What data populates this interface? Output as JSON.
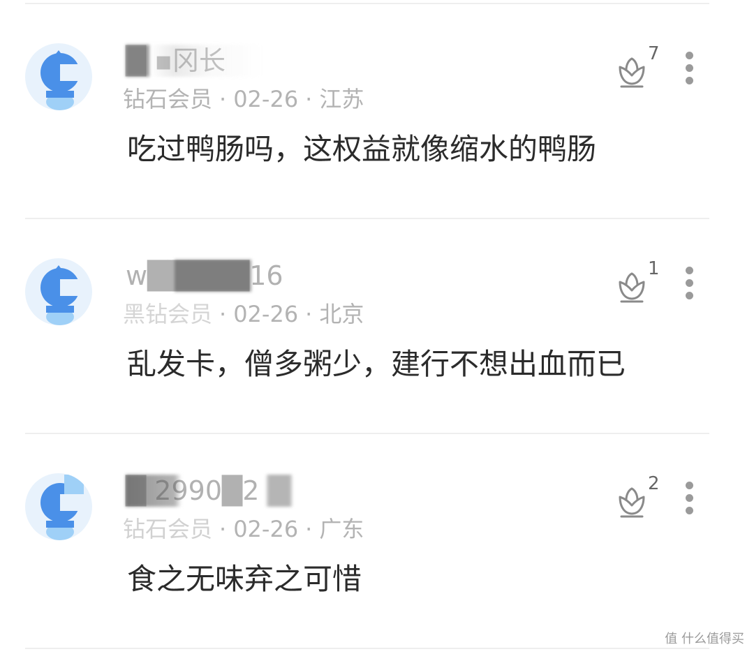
{
  "comments": [
    {
      "username": "█    ▪冈长",
      "member_level": "钻石会员",
      "date": "02-26",
      "location": "江苏",
      "content": "吃过鸭肠吗，这权益就像缩水的鸭肠",
      "like_count": "7"
    },
    {
      "username": "w█████16",
      "member_level": "黑钻会员",
      "date": "02-26",
      "location": "北京",
      "content": "乱发卡，僧多粥少，建行不想出血而已",
      "like_count": "1"
    },
    {
      "username": "█ 2990█2",
      "member_level": "钻石会员",
      "date": "02-26",
      "location": "广东",
      "content": "食之无味弃之可惜",
      "like_count": "2"
    }
  ],
  "separator": "·",
  "watermark": "值 什么值得买",
  "colors": {
    "avatar_bg": "#e8f2fc",
    "avatar_blue": "#4a90e8",
    "avatar_light": "#9fd0f7"
  },
  "icons": {
    "like": "lotus-like-icon",
    "more": "more-vertical-icon",
    "avatar": "default-avatar-icon"
  }
}
